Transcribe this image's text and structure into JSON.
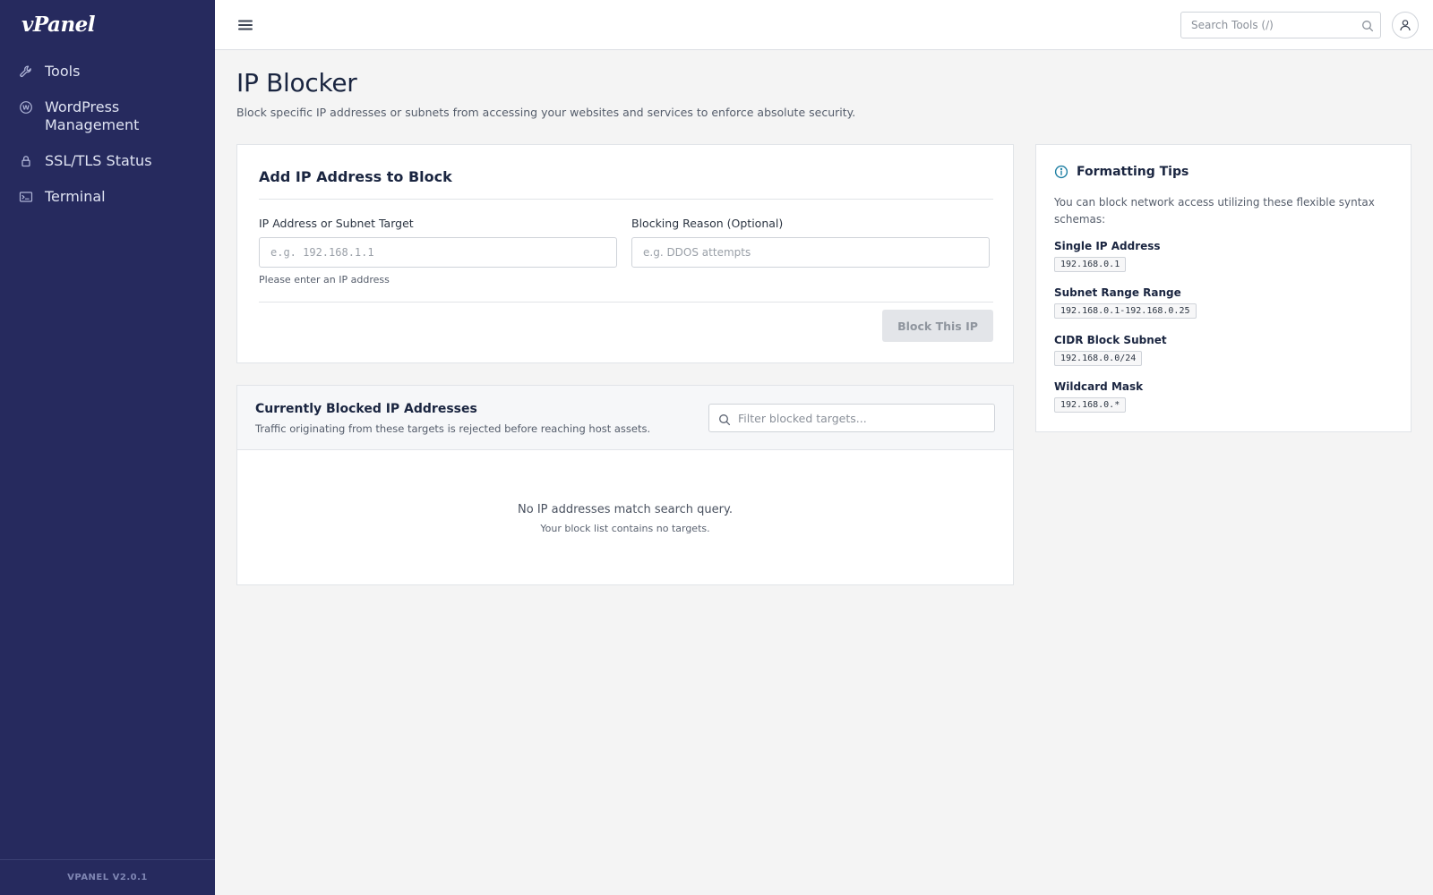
{
  "app": {
    "logo": "vPanel",
    "version": "VPANEL V2.0.1"
  },
  "sidebar": {
    "items": [
      {
        "label": "Tools",
        "icon": "wrench-icon"
      },
      {
        "label": "WordPress Management",
        "icon": "wordpress-icon"
      },
      {
        "label": "SSL/TLS Status",
        "icon": "lock-icon"
      },
      {
        "label": "Terminal",
        "icon": "terminal-icon"
      }
    ]
  },
  "topbar": {
    "search_placeholder": "Search Tools (/)"
  },
  "page": {
    "title": "IP Blocker",
    "subtitle": "Block specific IP addresses or subnets from accessing your websites and services to enforce absolute security."
  },
  "add_form": {
    "heading": "Add IP Address to Block",
    "ip_label": "IP Address or Subnet Target",
    "ip_placeholder": "e.g. 192.168.1.1",
    "ip_hint": "Please enter an IP address",
    "reason_label": "Blocking Reason (Optional)",
    "reason_placeholder": "e.g. DDOS attempts",
    "submit_label": "Block This IP"
  },
  "blocked_list": {
    "heading": "Currently Blocked IP Addresses",
    "description": "Traffic originating from these targets is rejected before reaching host assets.",
    "filter_placeholder": "Filter blocked targets...",
    "empty_title": "No IP addresses match search query.",
    "empty_subtitle": "Your block list contains no targets."
  },
  "tips": {
    "heading": "Formatting Tips",
    "intro": "You can block network access utilizing these flexible syntax schemas:",
    "items": [
      {
        "label": "Single IP Address",
        "example": "192.168.0.1"
      },
      {
        "label": "Subnet Range Range",
        "example": "192.168.0.1-192.168.0.25"
      },
      {
        "label": "CIDR Block Subnet",
        "example": "192.168.0.0/24"
      },
      {
        "label": "Wildcard Mask",
        "example": "192.168.0.*"
      }
    ]
  },
  "colors": {
    "sidebar_bg": "#262a5e",
    "accent": "#1e7fa3",
    "button_disabled_bg": "#e3e5e9"
  }
}
